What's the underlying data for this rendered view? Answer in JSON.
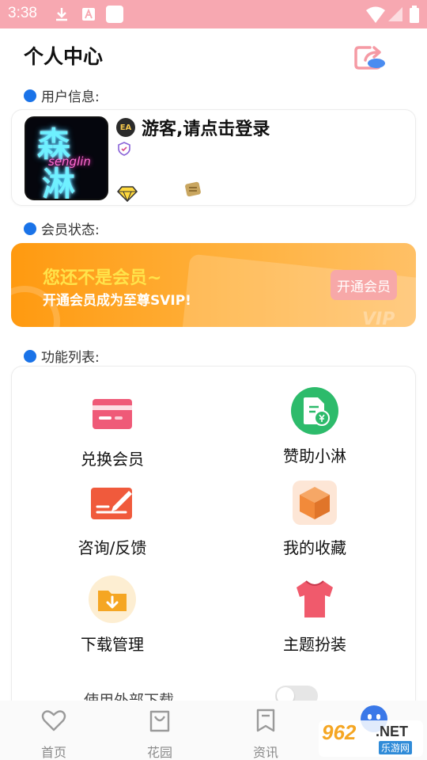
{
  "status_bar": {
    "time": "3:38"
  },
  "header": {
    "title": "个人中心"
  },
  "sections": {
    "user_info": "用户信息:",
    "member_status": "会员状态:",
    "function_list": "功能列表:"
  },
  "user": {
    "avatar_text_1": "森",
    "avatar_text_2": "淋",
    "avatar_script": "senglin",
    "name": "游客,请点击登录",
    "level_badge": "EA"
  },
  "vip": {
    "title": "您还不是会员~",
    "subtitle": "开通会员成为至尊SVIP!",
    "button": "开通会员",
    "mark": "VIP"
  },
  "functions": [
    {
      "label": "兑换会员",
      "icon": "card-icon",
      "color": "#ef5a78"
    },
    {
      "label": "赞助小淋",
      "icon": "money-document-icon",
      "color": "#2dbb6b"
    },
    {
      "label": "咨询/反馈",
      "icon": "edit-card-icon",
      "color": "#f05a3c"
    },
    {
      "label": "我的收藏",
      "icon": "box-icon",
      "color": "#f28a3a"
    },
    {
      "label": "下载管理",
      "icon": "download-folder-icon",
      "color": "#f5a623"
    },
    {
      "label": "主题扮装",
      "icon": "tshirt-icon",
      "color": "#f05a6c"
    }
  ],
  "external_download": {
    "label": "使用外部下载",
    "enabled": false
  },
  "tabbar": [
    {
      "label": "首页",
      "icon": "heart-icon"
    },
    {
      "label": "花园",
      "icon": "bag-icon"
    },
    {
      "label": "资讯",
      "icon": "bookmark-icon"
    }
  ],
  "watermark": {
    "big": "962",
    "net": ".NET",
    "sub": "乐游网"
  }
}
